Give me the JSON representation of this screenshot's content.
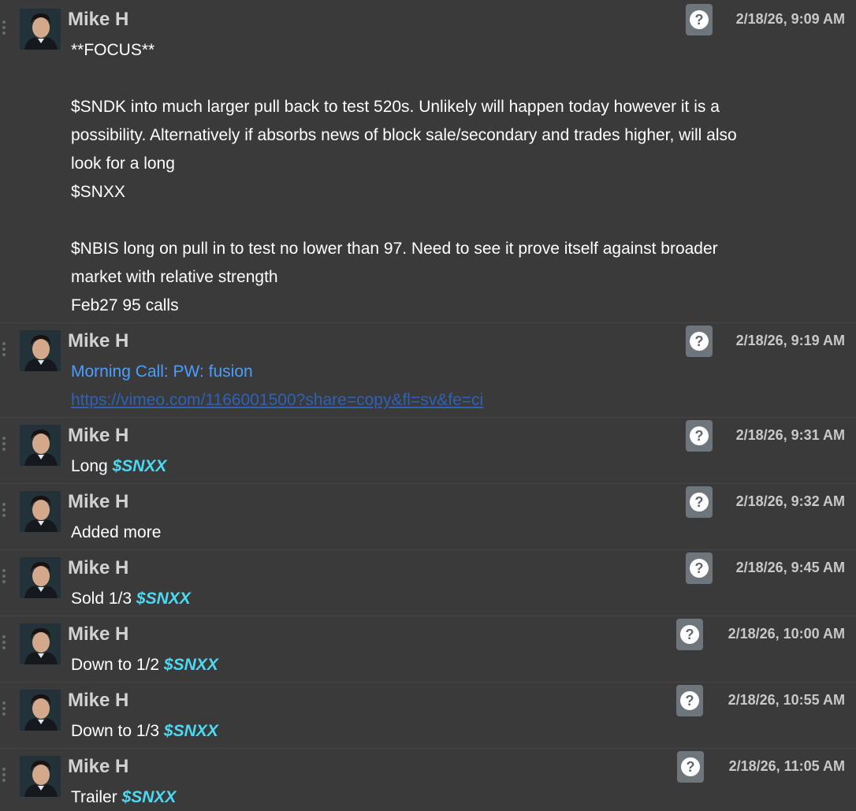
{
  "author": "Mike H",
  "messages": [
    {
      "timestamp": "2/18/26, 9:09 AM",
      "lines": [
        "**FOCUS**",
        "",
        "$SNDK into much larger pull back to test 520s. Unlikely will happen today however it is a",
        "possibility. Alternatively if absorbs news of block sale/secondary and trades higher, will also",
        "look for a long",
        "$SNXX",
        "",
        "$NBIS long on pull in to test no lower than 97. Need to see it prove itself against broader",
        "market with relative strength",
        "Feb27 95 calls"
      ]
    },
    {
      "timestamp": "2/18/26, 9:19 AM",
      "link_title": "Morning Call: PW: fusion",
      "link_url": "https://vimeo.com/1166001500?share=copy&fl=sv&fe=ci"
    },
    {
      "timestamp": "2/18/26, 9:31 AM",
      "text": "Long ",
      "ticker": "$SNXX"
    },
    {
      "timestamp": "2/18/26, 9:32 AM",
      "text": "Added more"
    },
    {
      "timestamp": "2/18/26, 9:45 AM",
      "text": "Sold 1/3 ",
      "ticker": "$SNXX"
    },
    {
      "timestamp": "2/18/26, 10:00 AM",
      "text": "Down to 1/2 ",
      "ticker": "$SNXX"
    },
    {
      "timestamp": "2/18/26, 10:55 AM",
      "text": "Down to 1/3 ",
      "ticker": "$SNXX"
    },
    {
      "timestamp": "2/18/26, 11:05 AM",
      "text": "Trailer ",
      "ticker": "$SNXX"
    }
  ],
  "icons": {
    "help": "question-circle-icon",
    "drag": "drag-handle-icon",
    "avatar": "avatar-photo"
  },
  "colors": {
    "background": "#3a3a3a",
    "ticker": "#4fd8f2",
    "link_title": "#4a9eff",
    "link_url": "#2d62b8",
    "help_badge": "#6e757b"
  }
}
